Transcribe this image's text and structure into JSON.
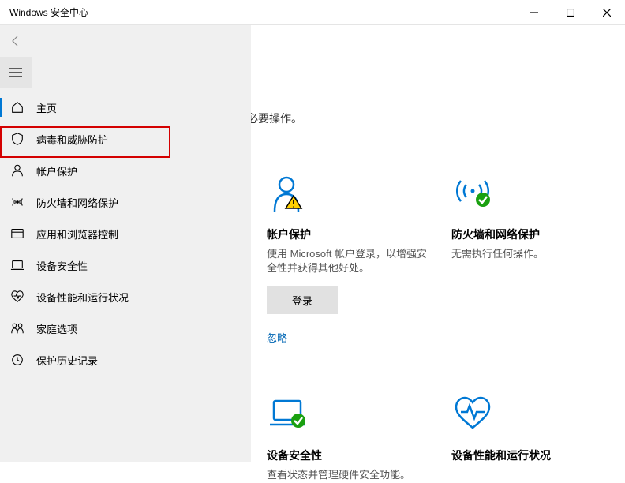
{
  "window": {
    "title": "Windows 安全中心"
  },
  "intro": "必要操作。",
  "sidebar": {
    "items": [
      {
        "label": "主页",
        "icon": "home-icon"
      },
      {
        "label": "病毒和威胁防护",
        "icon": "shield-icon"
      },
      {
        "label": "帐户保护",
        "icon": "person-icon"
      },
      {
        "label": "防火墙和网络保护",
        "icon": "network-icon"
      },
      {
        "label": "应用和浏览器控制",
        "icon": "browser-icon"
      },
      {
        "label": "设备安全性",
        "icon": "device-icon"
      },
      {
        "label": "设备性能和运行状况",
        "icon": "health-icon"
      },
      {
        "label": "家庭选项",
        "icon": "family-icon"
      },
      {
        "label": "保护历史记录",
        "icon": "history-icon"
      }
    ]
  },
  "cards": {
    "account": {
      "title": "帐户保护",
      "desc": "使用 Microsoft 帐户登录，以增强安全性并获得其他好处。",
      "button": "登录",
      "link": "忽略"
    },
    "firewall": {
      "title": "防火墙和网络保护",
      "desc": "无需执行任何操作。"
    },
    "device": {
      "title": "设备安全性",
      "desc": "查看状态并管理硬件安全功能。"
    },
    "health": {
      "title": "设备性能和运行状况",
      "desc": ""
    }
  }
}
